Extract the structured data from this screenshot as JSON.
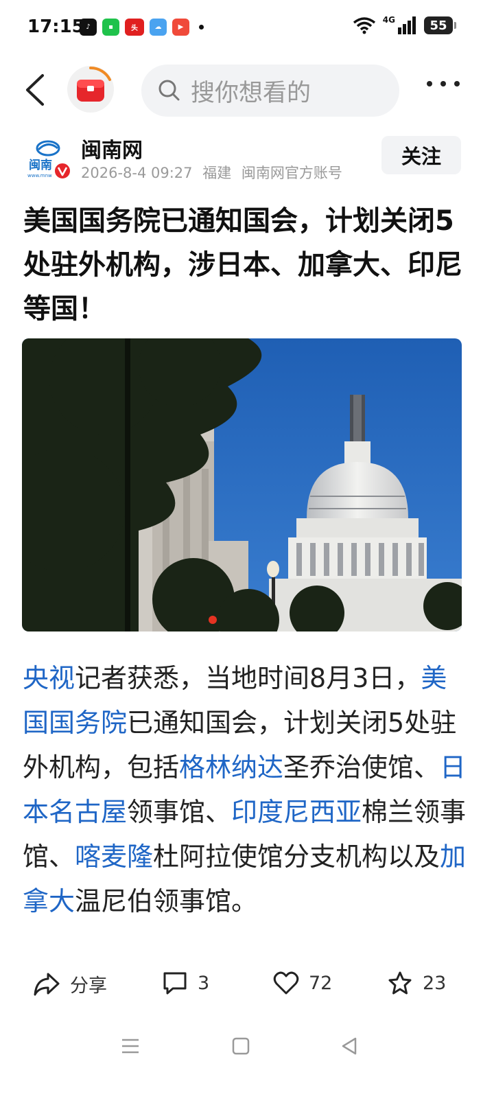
{
  "status_bar": {
    "time": "17:15",
    "network": "4G",
    "battery": "55"
  },
  "search": {
    "placeholder": "搜你想看的"
  },
  "author": {
    "name": "闽南网",
    "avatar_text": "闽南",
    "date": "2026-8-4 09:27",
    "location": "福建",
    "account": "闽南网官方账号",
    "follow_label": "关注"
  },
  "article": {
    "title": "美国国务院已通知国会，计划关闭5处驻外机构，涉日本、加拿大、印尼等国！",
    "body": {
      "p1_link1": "央视",
      "p1_t1": "记者获悉，当地时间8月3日，",
      "p1_link2": "美国国务院",
      "p1_t2": "已通知国会，计划关闭5处驻外机构，包括",
      "p1_link3": "格林纳达",
      "p1_t3": "圣乔治使馆、",
      "p1_link4": "日本名古屋",
      "p1_t4": "领事馆、",
      "p1_link5": "印度尼西亚",
      "p1_t5": "棉兰领事馆、",
      "p1_link6": "喀麦隆",
      "p1_t6": "杜阿拉使馆分支机构以及",
      "p1_link7": "加拿大",
      "p1_t7": "温尼伯领事馆。"
    }
  },
  "actions": {
    "share_label": "分享",
    "comments": "3",
    "likes": "72",
    "favorites": "23"
  },
  "colors": {
    "link": "#1f66c6",
    "sky": "#2d6fc2",
    "logo_red": "#e6262b"
  }
}
